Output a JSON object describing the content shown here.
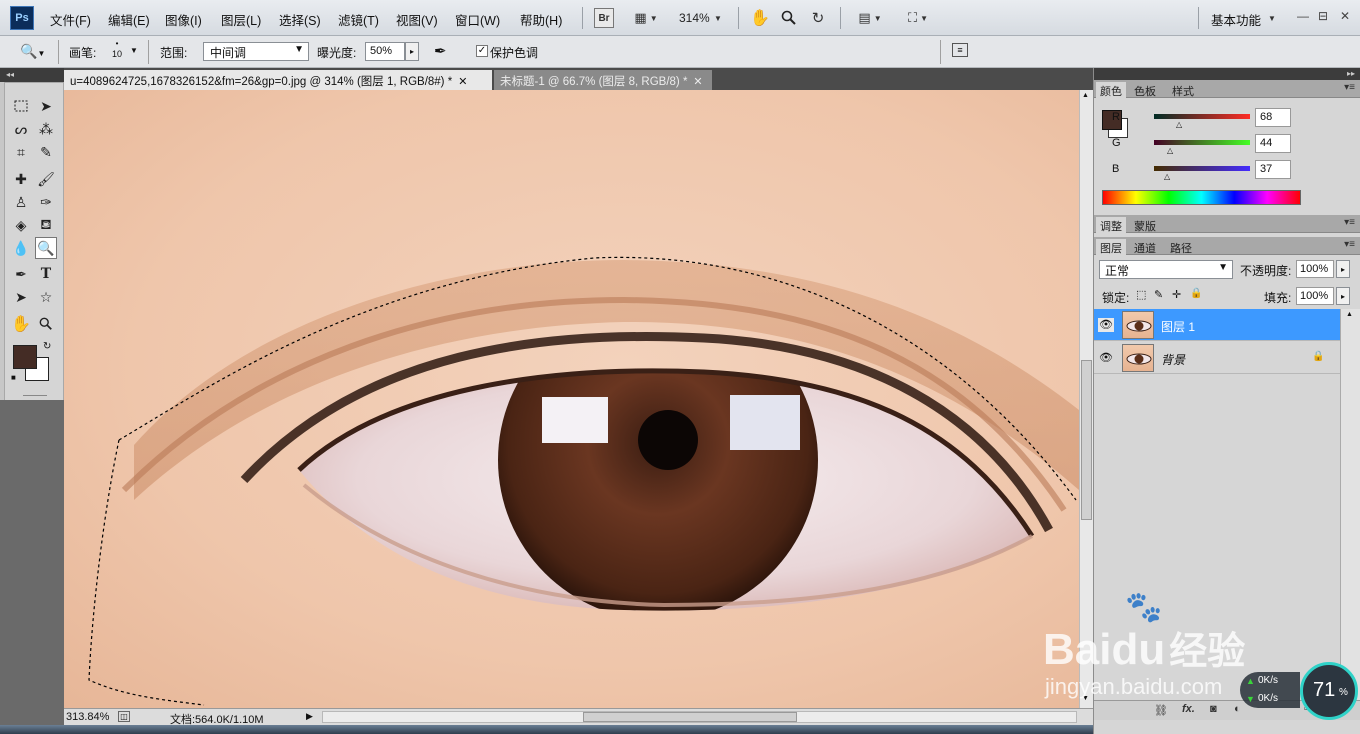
{
  "app": {
    "logo": "Ps"
  },
  "menu": [
    "文件(F)",
    "编辑(E)",
    "图像(I)",
    "图层(L)",
    "选择(S)",
    "滤镜(T)",
    "视图(V)",
    "窗口(W)",
    "帮助(H)"
  ],
  "menubar": {
    "bridge_label": "Br",
    "zoom": "314%",
    "workspace": "基本功能",
    "minimize": "—",
    "restore": "⊟",
    "close": "✕"
  },
  "options": {
    "brush_label": "画笔:",
    "brush_size": "10",
    "range_label": "范围:",
    "range_value": "中间调",
    "exposure_label": "曝光度:",
    "exposure_value": "50%",
    "protect_label": "保护色调"
  },
  "tabs": [
    {
      "title": "u=4089624725,1678326152&fm=26&gp=0.jpg @ 314% (图层 1, RGB/8#) *",
      "close": "✕"
    },
    {
      "title": "未标题-1 @ 66.7% (图层 8, RGB/8) *",
      "close": "✕"
    }
  ],
  "status": {
    "zoom": "313.84%",
    "doc_label": "文档:564.0K/1.10M"
  },
  "color_panel": {
    "tabs": [
      "颜色",
      "色板",
      "样式"
    ],
    "r": {
      "label": "R",
      "value": "68"
    },
    "g": {
      "label": "G",
      "value": "44"
    },
    "b": {
      "label": "B",
      "value": "37"
    },
    "foreground": "#442c25",
    "background": "#ffffff"
  },
  "adjust_panel": {
    "tabs": [
      "调整",
      "蒙版"
    ]
  },
  "layers_panel": {
    "tabs": [
      "图层",
      "通道",
      "路径"
    ],
    "blend_mode": "正常",
    "opacity_label": "不透明度:",
    "opacity_value": "100%",
    "lock_label": "锁定:",
    "fill_label": "填充:",
    "fill_value": "100%",
    "layers": [
      {
        "name": "图层 1",
        "selected": true
      },
      {
        "name": "背景",
        "selected": false,
        "locked": true
      }
    ]
  },
  "watermark": {
    "brand": "Bai",
    "brand2": "du",
    "cn": "经验",
    "url": "jingyan.baidu.com"
  },
  "speed_widget": {
    "up": "0K/s",
    "down": "0K/s",
    "percent": "71",
    "unit": "%"
  }
}
